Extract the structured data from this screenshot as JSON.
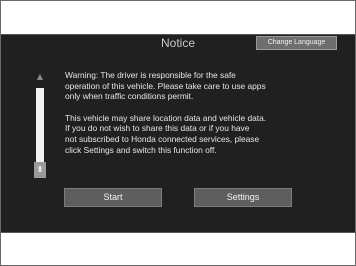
{
  "dialog": {
    "title": "Notice",
    "change_language_label": "Change Language",
    "paragraph_1": "Warning: The driver is responsible for the safe\noperation of this vehicle. Please take care to use apps\nonly when traffic conditions permit.",
    "paragraph_2": "This vehicle may share location data and vehicle data.\nIf you do not wish to share this data or if you have\nnot subscribed to Honda connected services, please\nclick Settings and switch this function off.",
    "start_label": "Start",
    "settings_label": "Settings"
  },
  "icons": {
    "scroll_up": "chevron-up-icon",
    "scroll_down": "chevron-down-icon"
  },
  "colors": {
    "screen_background": "#202020",
    "button_background": "#5e5e5e",
    "text": "#e6e6e6"
  }
}
